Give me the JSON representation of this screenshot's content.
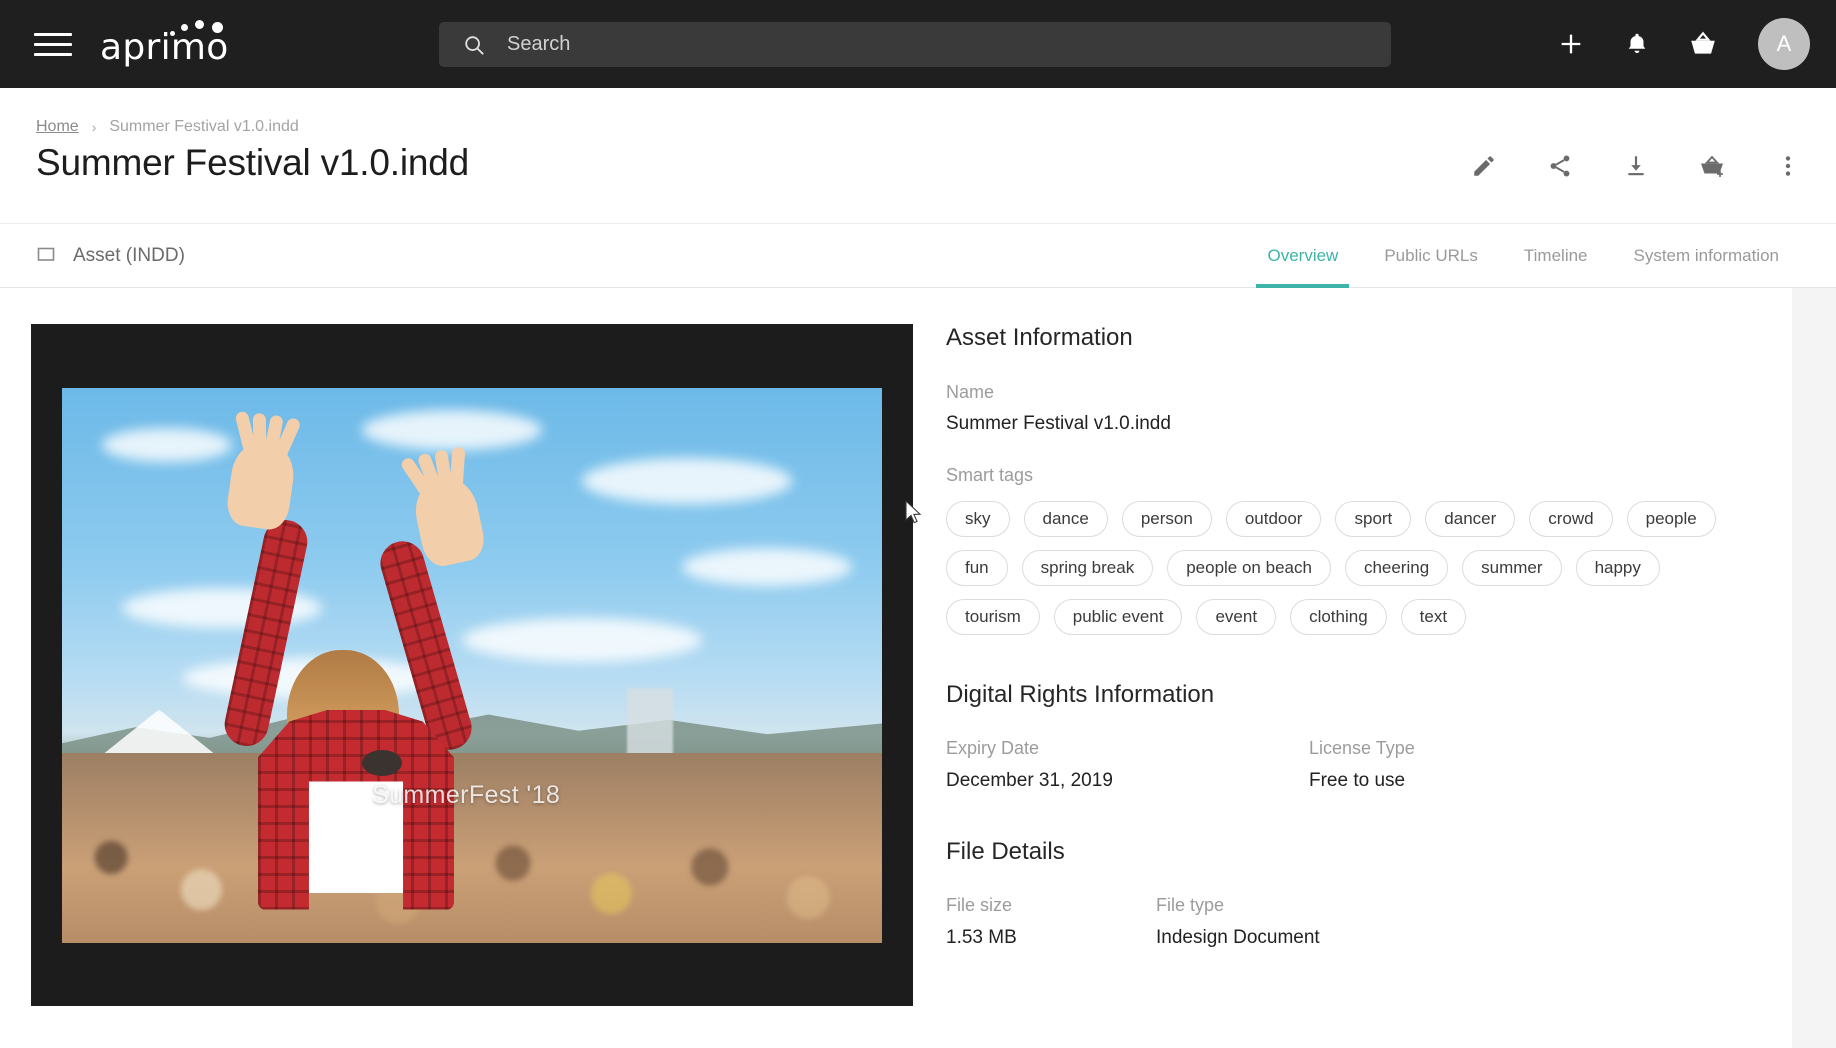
{
  "topbar": {
    "menu_icon": "hamburger-menu-icon",
    "brand": "aprimo",
    "brand_tm": "®",
    "search": {
      "placeholder": "Search",
      "value": "",
      "icon": "search-icon"
    },
    "actions": [
      {
        "name": "add-button",
        "icon": "plus-icon"
      },
      {
        "name": "notifications-button",
        "icon": "bell-icon"
      },
      {
        "name": "basket-button",
        "icon": "basket-icon"
      }
    ],
    "avatar_initial": "A"
  },
  "header": {
    "breadcrumb": {
      "home": "Home",
      "separator": "›",
      "current": "Summer Festival v1.0.indd"
    },
    "title": "Summer Festival v1.0.indd",
    "actions": [
      {
        "name": "edit-button",
        "icon": "pencil-icon"
      },
      {
        "name": "share-button",
        "icon": "share-icon"
      },
      {
        "name": "download-button",
        "icon": "download-icon"
      },
      {
        "name": "add-to-basket-button",
        "icon": "basket-plus-icon"
      },
      {
        "name": "more-options-button",
        "icon": "more-vertical-icon"
      }
    ]
  },
  "tabbar": {
    "asset_kind_icon": "crop-rectangle-icon",
    "asset_kind": "Asset (INDD)",
    "tabs": [
      {
        "label": "Overview",
        "active": true
      },
      {
        "label": "Public URLs",
        "active": false
      },
      {
        "label": "Timeline",
        "active": false
      },
      {
        "label": "System information",
        "active": false
      }
    ],
    "accent_color": "#3eb3a7"
  },
  "preview": {
    "watermark": "SummerFest '18",
    "background_color": "#1c1c1c"
  },
  "asset_information": {
    "section_title": "Asset Information",
    "name_label": "Name",
    "name_value": "Summer Festival v1.0.indd",
    "smart_tags_label": "Smart tags",
    "smart_tags": [
      "sky",
      "dance",
      "person",
      "outdoor",
      "sport",
      "dancer",
      "crowd",
      "people",
      "fun",
      "spring break",
      "people on beach",
      "cheering",
      "summer",
      "happy",
      "tourism",
      "public event",
      "event",
      "clothing",
      "text"
    ]
  },
  "digital_rights": {
    "section_title": "Digital Rights Information",
    "expiry_label": "Expiry Date",
    "expiry_value": "December 31, 2019",
    "license_label": "License Type",
    "license_value": "Free to use"
  },
  "file_details": {
    "section_title": "File Details",
    "size_label": "File size",
    "size_value": "1.53 MB",
    "type_label": "File type",
    "type_value": "Indesign Document"
  }
}
